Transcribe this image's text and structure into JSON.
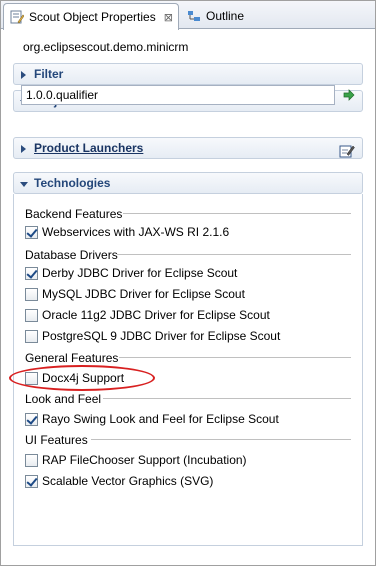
{
  "tabs": [
    {
      "label": "Scout Object Properties",
      "close": "⊠",
      "icon": "properties-icon"
    },
    {
      "label": "Outline",
      "icon": "outline-icon"
    }
  ],
  "module": "org.eclipsescout.demo.minicrm",
  "sections": {
    "filter": "Filter",
    "project_version": "Project Version",
    "product_launchers": "Product Launchers",
    "technologies": "Technologies"
  },
  "version_value": "1.0.0.qualifier",
  "groups": [
    {
      "label": "Backend Features",
      "items": [
        {
          "label": "Webservices with JAX-WS RI 2.1.6",
          "checked": true
        }
      ]
    },
    {
      "label": "Database Drivers",
      "items": [
        {
          "label": "Derby JDBC Driver for Eclipse Scout",
          "checked": true
        },
        {
          "label": "MySQL JDBC Driver for Eclipse Scout",
          "checked": false
        },
        {
          "label": "Oracle 11g2 JDBC Driver for Eclipse Scout",
          "checked": false
        },
        {
          "label": "PostgreSQL 9 JDBC Driver for Eclipse Scout",
          "checked": false
        }
      ]
    },
    {
      "label": "General Features",
      "items": [
        {
          "label": "Docx4j Support",
          "checked": false
        }
      ]
    },
    {
      "label": "Look and Feel",
      "items": [
        {
          "label": "Rayo Swing Look and Feel for Eclipse Scout",
          "checked": true
        }
      ]
    },
    {
      "label": "UI Features",
      "items": [
        {
          "label": "RAP FileChooser Support (Incubation)",
          "checked": false
        },
        {
          "label": "Scalable Vector Graphics (SVG)",
          "checked": true
        }
      ]
    }
  ],
  "colors": {
    "accent": "#24477a",
    "highlight": "#d82020"
  }
}
